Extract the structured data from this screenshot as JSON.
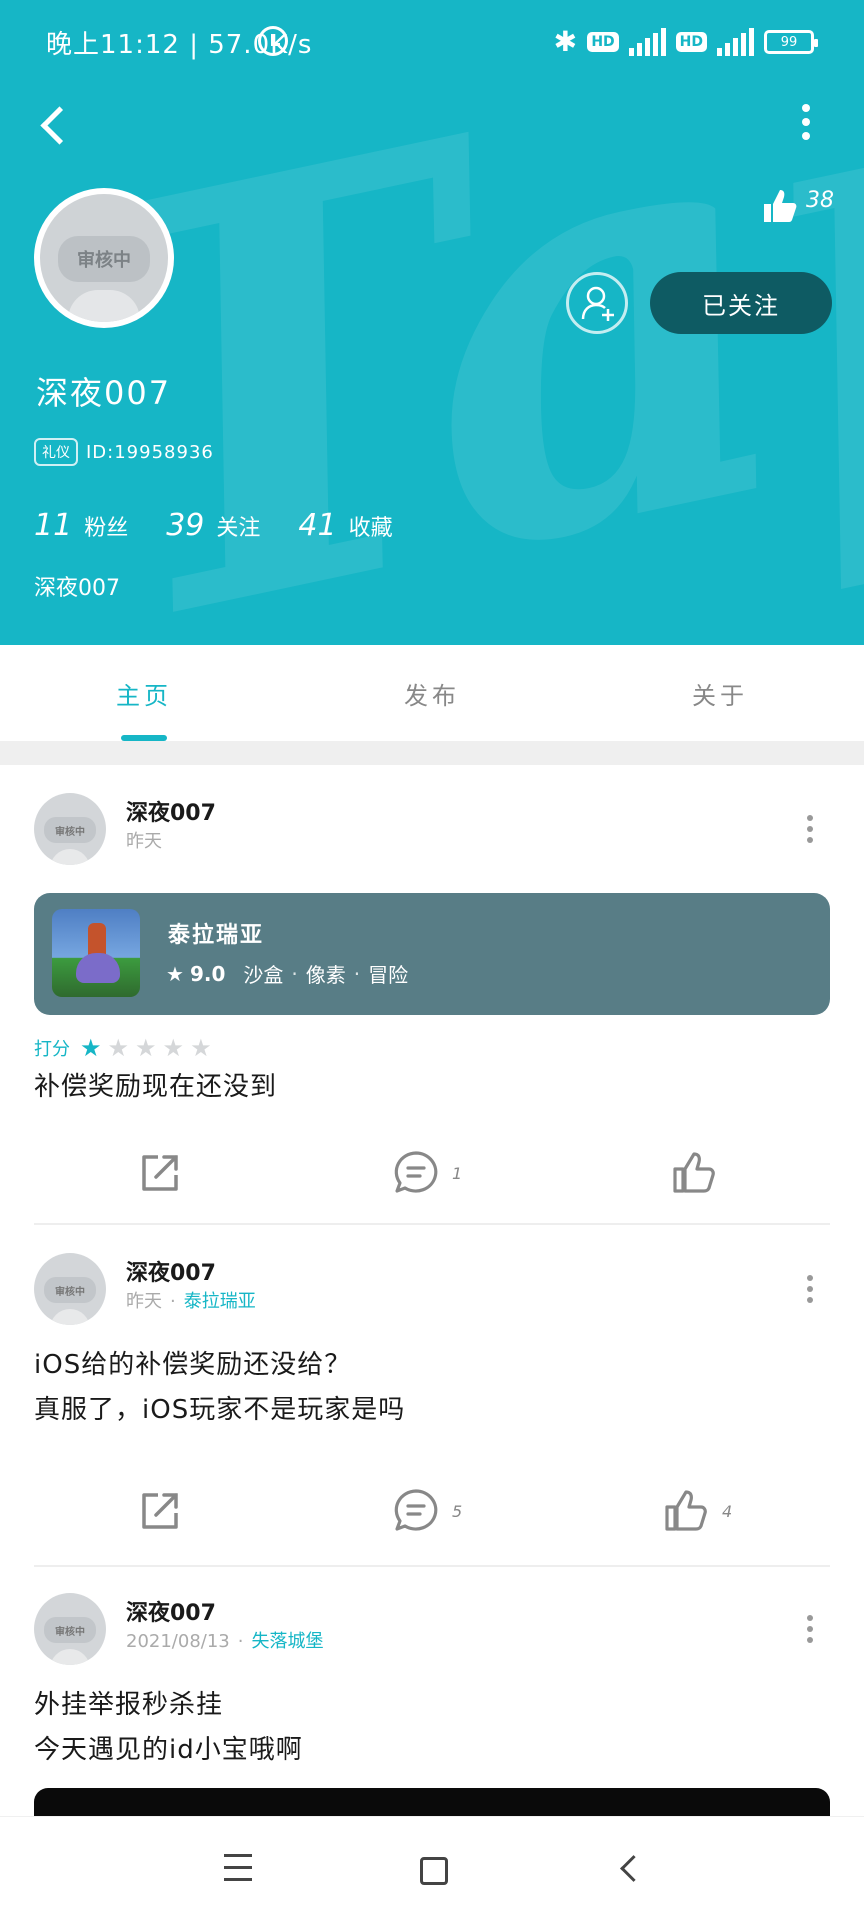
{
  "status_bar": {
    "time": "晚上11:12 | 57.0K/s",
    "battery": "99",
    "network": "4G"
  },
  "profile": {
    "likes": "38",
    "avatar_badge": "审核中",
    "name": "深夜007",
    "badge": "礼仪",
    "id": "ID:19958936",
    "stats": [
      {
        "num": "11",
        "label": "粉丝"
      },
      {
        "num": "39",
        "label": "关注"
      },
      {
        "num": "41",
        "label": "收藏"
      }
    ],
    "bio": "深夜007",
    "follow_label": "已关注"
  },
  "tabs": [
    {
      "label": "主页",
      "active": true
    },
    {
      "label": "发布",
      "active": false
    },
    {
      "label": "关于",
      "active": false
    }
  ],
  "posts": [
    {
      "author": "深夜007",
      "time": "昨天",
      "avatar_badge": "审核中",
      "game": {
        "title": "泰拉瑞亚",
        "score": "9.0",
        "tags": [
          "沙盒",
          "像素",
          "冒险"
        ]
      },
      "rating_label": "打分",
      "rating": 1,
      "rating_max": 5,
      "text": "补偿奖励现在还没到",
      "comments": "1",
      "likes": ""
    },
    {
      "author": "深夜007",
      "time": "昨天",
      "game_link": "泰拉瑞亚",
      "avatar_badge": "审核中",
      "text_lines": [
        "iOS给的补偿奖励还没给？",
        "真服了，iOS玩家不是玩家是吗"
      ],
      "comments": "5",
      "likes": "4"
    },
    {
      "author": "深夜007",
      "time": "2021/08/13",
      "game_link": "失落城堡",
      "avatar_badge": "审核中",
      "text_lines": [
        "外挂举报秒杀挂",
        "今天遇见的id小宝哦啊"
      ]
    }
  ],
  "colors": {
    "accent": "#16b6c6",
    "followed_bg": "#0e5b63",
    "game_card": "#587d86"
  }
}
